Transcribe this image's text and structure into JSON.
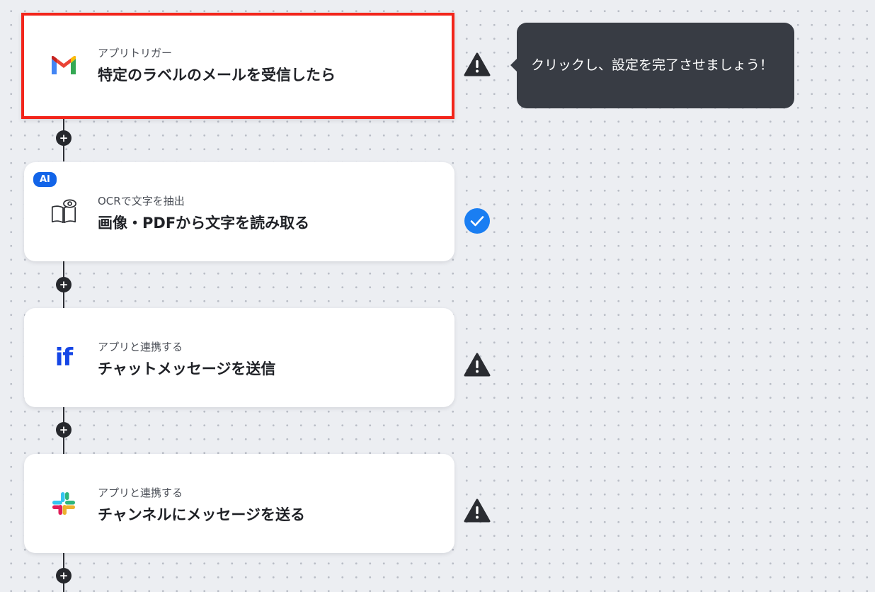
{
  "flow": {
    "steps": [
      {
        "subtitle": "アプリトリガー",
        "title": "特定のラベルのメールを受信したら",
        "icon": "gmail-icon",
        "status": "warning-icon"
      },
      {
        "badge": "AI",
        "subtitle": "OCRで文字を抽出",
        "title": "画像・PDFから文字を読み取る",
        "icon": "book-eye-icon",
        "status": "check-icon"
      },
      {
        "subtitle": "アプリと連携する",
        "title": "チャットメッセージを送信",
        "icon": "if-icon",
        "icon_text": "if",
        "status": "warning-icon"
      },
      {
        "subtitle": "アプリと連携する",
        "title": "チャンネルにメッセージを送る",
        "icon": "slack-icon",
        "status": "warning-icon"
      }
    ],
    "add_step_symbol": "+"
  },
  "tooltip": {
    "text": "クリックし、設定を完了させましょう！"
  },
  "colors": {
    "selection": "#f2251b",
    "ai_badge": "#1264e8",
    "check": "#1a7ef2",
    "warning": "#2a2c31",
    "tooltip_bg": "#383c44"
  }
}
